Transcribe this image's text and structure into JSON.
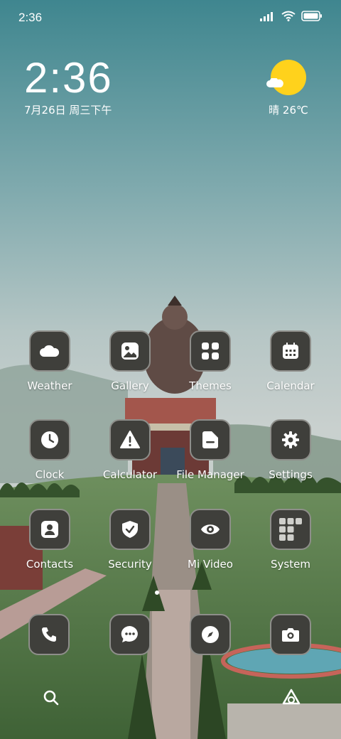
{
  "status_bar": {
    "time": "2:36",
    "icons": [
      "signal-icon",
      "wifi-icon",
      "battery-icon"
    ]
  },
  "clock_widget": {
    "time": "2:36",
    "date": "7月26日 周三下午"
  },
  "weather_widget": {
    "icon": "partly-sunny-icon",
    "condition_temp": "晴 26℃"
  },
  "apps": [
    {
      "label": "Weather",
      "icon": "cloud-icon"
    },
    {
      "label": "Gallery",
      "icon": "image-icon"
    },
    {
      "label": "Themes",
      "icon": "grid-icon"
    },
    {
      "label": "Calendar",
      "icon": "calendar-icon"
    },
    {
      "label": "Clock",
      "icon": "clock-icon"
    },
    {
      "label": "Calculator",
      "icon": "warning-icon"
    },
    {
      "label": "File Manager",
      "icon": "folder-icon"
    },
    {
      "label": "Settings",
      "icon": "gear-icon"
    },
    {
      "label": "Contacts",
      "icon": "person-icon"
    },
    {
      "label": "Security",
      "icon": "shield-check-icon"
    },
    {
      "label": "Mi Video",
      "icon": "eye-icon"
    },
    {
      "label": "System",
      "icon": "folder-grid-icon"
    }
  ],
  "dock": [
    {
      "icon": "phone-icon"
    },
    {
      "icon": "message-icon"
    },
    {
      "icon": "compass-icon"
    },
    {
      "icon": "camera-icon"
    }
  ],
  "bottom_bar": {
    "left_icon": "search-icon",
    "right_icon": "assistant-icon"
  },
  "colors": {
    "tile_bg": "#3f3f3b",
    "tile_border": "#8e8e8a",
    "sun": "#ffd21c"
  }
}
